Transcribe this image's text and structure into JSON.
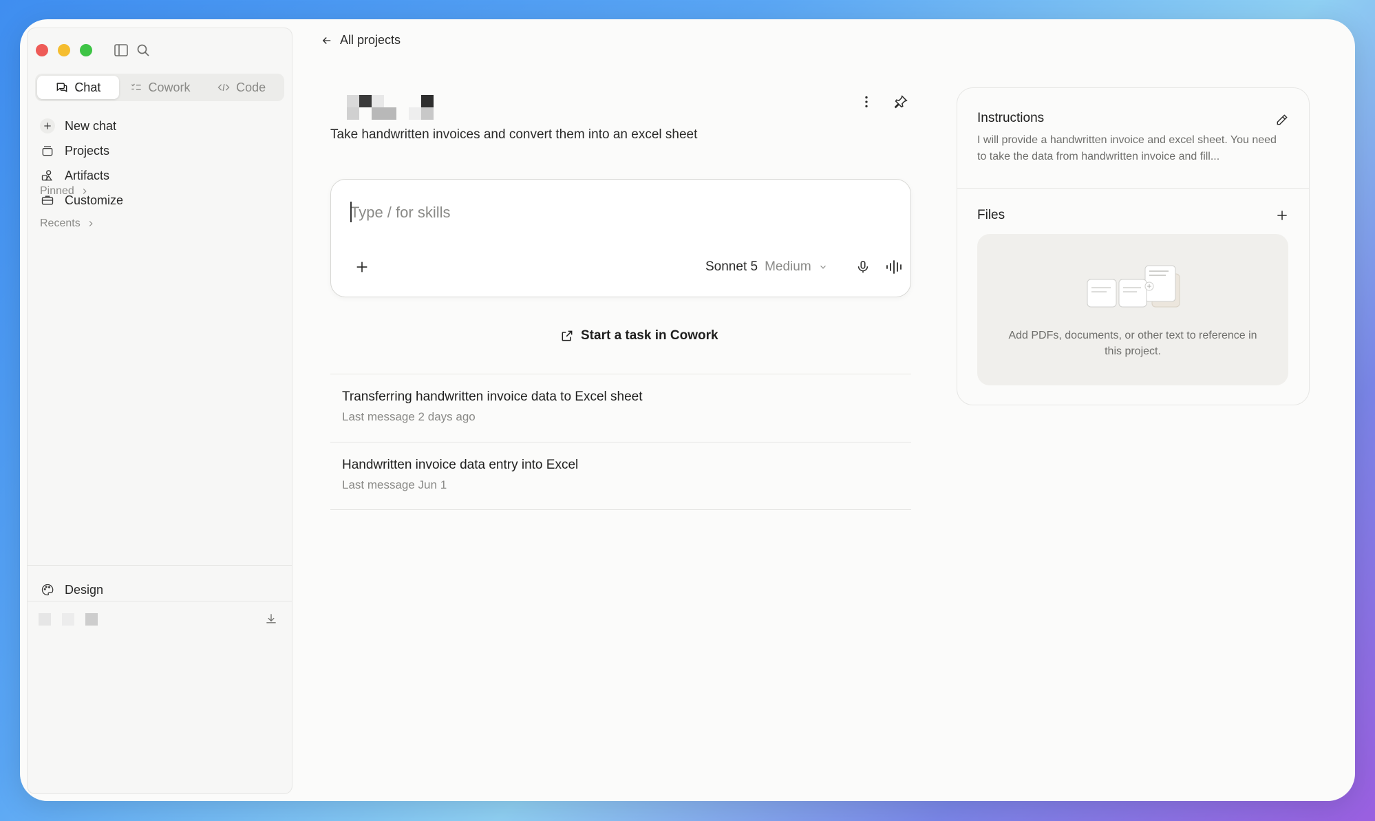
{
  "sidebar": {
    "modes": [
      {
        "label": "Chat",
        "active": true
      },
      {
        "label": "Cowork",
        "active": false
      },
      {
        "label": "Code",
        "active": false
      }
    ],
    "nav": [
      {
        "label": "New chat",
        "icon": "plus-icon"
      },
      {
        "label": "Projects",
        "icon": "projects-icon"
      },
      {
        "label": "Artifacts",
        "icon": "artifacts-icon"
      },
      {
        "label": "Customize",
        "icon": "briefcase-icon"
      }
    ],
    "pinned_label": "Pinned",
    "recents_label": "Recents",
    "design_label": "Design"
  },
  "main": {
    "back_label": "All projects",
    "project_description": "Take handwritten invoices and convert them into an excel sheet",
    "composer": {
      "placeholder": "Type / for skills",
      "model_name": "Sonnet 5",
      "model_level": "Medium"
    },
    "cowork_label": "Start a task in Cowork",
    "chats": [
      {
        "title": "Transferring handwritten invoice data to Excel sheet",
        "meta": "Last message 2 days ago"
      },
      {
        "title": "Handwritten invoice data entry into Excel",
        "meta": "Last message Jun 1"
      }
    ]
  },
  "right_panel": {
    "instructions_title": "Instructions",
    "instructions_text": "I will provide a handwritten invoice and excel sheet. You need to take the data from handwritten invoice and fill...",
    "files_title": "Files",
    "files_empty_text": "Add PDFs, documents, or other text to reference in this project."
  },
  "colors": {
    "accent_red": "#ee5b57",
    "accent_yellow": "#f5bd2f",
    "accent_green": "#3ec445"
  }
}
